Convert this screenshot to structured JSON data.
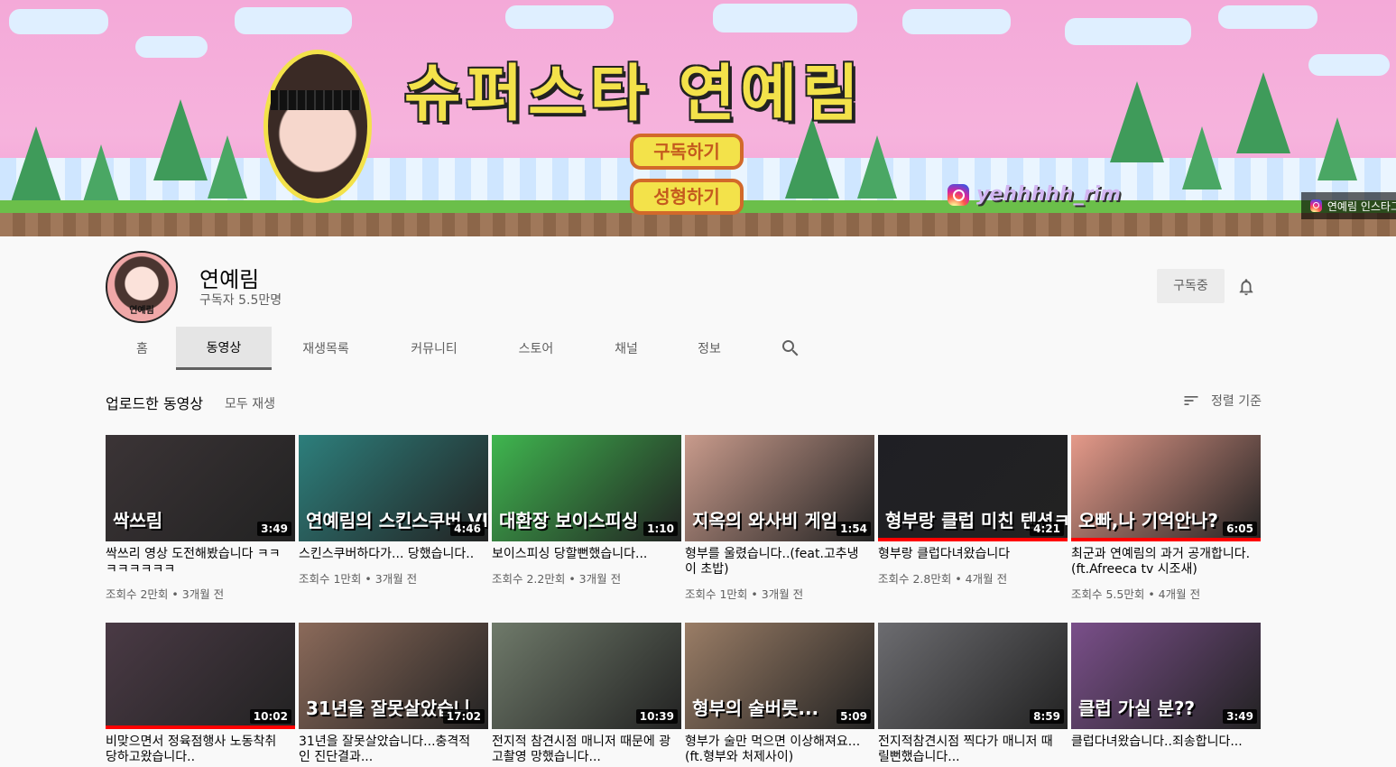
{
  "banner": {
    "title": "슈퍼스타 연예림",
    "button_subscribe": "구독하기",
    "button_surgery": "성형하기",
    "instagram_handle": "yehhhhh_rim",
    "link_chip_label": "연예림 인스타그"
  },
  "channel": {
    "name": "연예림",
    "avatar_label": "연예림",
    "subscribers": "구독자 5.5만명",
    "subscribed_label": "구독중"
  },
  "tabs": [
    {
      "label": "홈"
    },
    {
      "label": "동영상"
    },
    {
      "label": "재생목록"
    },
    {
      "label": "커뮤니티"
    },
    {
      "label": "스토어"
    },
    {
      "label": "채널"
    },
    {
      "label": "정보"
    }
  ],
  "section": {
    "title": "업로드한 동영상",
    "play_all": "모두 재생",
    "sort_label": "정렬 기준"
  },
  "videos": [
    {
      "title": "싹쓰리 영상 도전해봤습니다 ㅋㅋㅋㅋㅋㅋㅋㅋ",
      "meta": "조회수 2만회 • 3개월 전",
      "duration": "3:49",
      "caption": "싹쓰림",
      "bg": "#3b3436",
      "watched": 0
    },
    {
      "title": "스킨스쿠버하다가... 당했습니다..",
      "meta": "조회수 1만회 • 3개월 전",
      "duration": "4:46",
      "caption": "연예림의 스킨스쿠버 Vlog",
      "bg": "#2d7f7c",
      "watched": 0
    },
    {
      "title": "보이스피싱 당할뻔했습니다...",
      "meta": "조회수 2.2만회 • 3개월 전",
      "duration": "1:10",
      "caption": "대환장 보이스피싱",
      "bg": "#3fb64f",
      "watched": 0
    },
    {
      "title": "형부를 울렸습니다..(feat.고추냉이 초밥)",
      "meta": "조회수 1만회 • 3개월 전",
      "duration": "1:54",
      "caption": "지옥의 와사비 게임",
      "bg": "#c99b8c",
      "watched": 0
    },
    {
      "title": "형부랑 클럽다녀왔습니다",
      "meta": "조회수 2.8만회 • 4개월 전",
      "duration": "4:21",
      "caption": "형부랑 클럽 미친 텐션ㅋㅋㅋ",
      "bg": "#1f1f24",
      "watched": 1
    },
    {
      "title": "최군과 연예림의 과거 공개합니다.(ft.Afreeca tv 시조새)",
      "meta": "조회수 5.5만회 • 4개월 전",
      "duration": "6:05",
      "caption": "오빠,나 기억안나?",
      "bg": "#e59a8a",
      "watched": 1
    },
    {
      "title": "비맞으면서 정육점행사 노동착취 당하고왔습니다..",
      "meta": "",
      "duration": "10:02",
      "caption": "",
      "bg": "#4a3a45",
      "watched": 1
    },
    {
      "title": "31년을 잘못살았습니다...충격적인 진단결과...",
      "meta": "",
      "duration": "17:02",
      "caption": "31년을 잘못살았습니",
      "bg": "#8b6a5a",
      "watched": 0
    },
    {
      "title": "전지적 참견시점 매니저 때문에 광고촬영 망했습니다...",
      "meta": "",
      "duration": "10:39",
      "caption": "",
      "bg": "#6f7a6a",
      "watched": 0
    },
    {
      "title": "형부가 술만 먹으면 이상해져요...(ft.형부와 처제사이)",
      "meta": "",
      "duration": "5:09",
      "caption": "형부의 술버릇...",
      "bg": "#9a7d66",
      "watched": 0
    },
    {
      "title": "전지적참견시점 찍다가 매니저 때릴뻔했습니다...",
      "meta": "",
      "duration": "8:59",
      "caption": "",
      "bg": "#6c6c70",
      "watched": 0
    },
    {
      "title": "클럽다녀왔습니다..죄송합니다...",
      "meta": "",
      "duration": "3:49",
      "caption": "클럽 가실 분??",
      "bg": "#7a4f8a",
      "watched": 0
    }
  ],
  "colors": {
    "accent_red": "#ff0000",
    "text_primary": "#030303",
    "text_secondary": "#606060"
  }
}
